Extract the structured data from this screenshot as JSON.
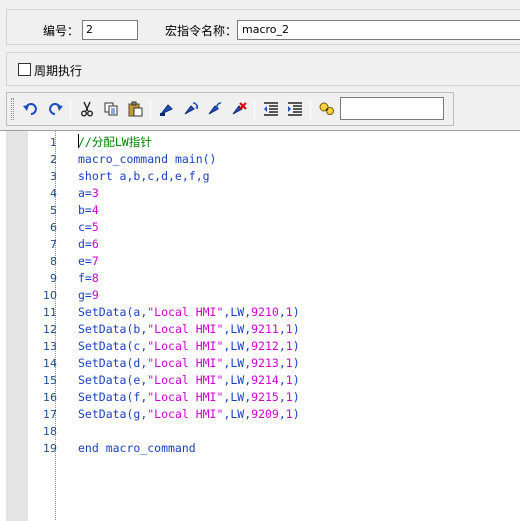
{
  "header": {
    "id_label": "编号：",
    "id_value": "2",
    "name_label": "宏指令名称：",
    "name_value": "macro_2"
  },
  "options": {
    "periodic_label": "周期执行",
    "periodic_checked": false
  },
  "toolbar": {
    "buttons": [
      "undo-icon",
      "redo-icon",
      "cut-icon",
      "copy-icon",
      "paste-icon",
      "bookmark-toggle-icon",
      "bookmark-next-icon",
      "bookmark-prev-icon",
      "bookmark-clear-icon",
      "outdent-icon",
      "indent-icon",
      "find-icon"
    ],
    "search_value": ""
  },
  "editor": {
    "line_numbers": [
      "1",
      "2",
      "3",
      "4",
      "5",
      "6",
      "7",
      "8",
      "9",
      "10",
      "11",
      "12",
      "13",
      "14",
      "15",
      "16",
      "17",
      "18",
      "19"
    ],
    "lines": [
      [
        {
          "t": "//分配LW指针",
          "c": "cmt"
        }
      ],
      [
        {
          "t": "macro_command",
          "c": "kw"
        },
        {
          "t": " main()",
          "c": "plain"
        }
      ],
      [
        {
          "t": "short",
          "c": "kw"
        },
        {
          "t": " a,b,c,d,e,f,g",
          "c": "plain"
        }
      ],
      [
        {
          "t": "a=",
          "c": "plain"
        },
        {
          "t": "3",
          "c": "num"
        }
      ],
      [
        {
          "t": "b=",
          "c": "plain"
        },
        {
          "t": "4",
          "c": "num"
        }
      ],
      [
        {
          "t": "c=",
          "c": "plain"
        },
        {
          "t": "5",
          "c": "num"
        }
      ],
      [
        {
          "t": "d=",
          "c": "plain"
        },
        {
          "t": "6",
          "c": "num"
        }
      ],
      [
        {
          "t": "e=",
          "c": "plain"
        },
        {
          "t": "7",
          "c": "num"
        }
      ],
      [
        {
          "t": "f=",
          "c": "plain"
        },
        {
          "t": "8",
          "c": "num"
        }
      ],
      [
        {
          "t": "g=",
          "c": "plain"
        },
        {
          "t": "9",
          "c": "num"
        }
      ],
      [
        {
          "t": "SetData",
          "c": "fn"
        },
        {
          "t": "(a,",
          "c": "plain"
        },
        {
          "t": "\"Local HMI\"",
          "c": "str"
        },
        {
          "t": ",LW,",
          "c": "plain"
        },
        {
          "t": "9210",
          "c": "num"
        },
        {
          "t": ",",
          "c": "plain"
        },
        {
          "t": "1",
          "c": "num"
        },
        {
          "t": ")",
          "c": "plain"
        }
      ],
      [
        {
          "t": "SetData",
          "c": "fn"
        },
        {
          "t": "(b,",
          "c": "plain"
        },
        {
          "t": "\"Local HMI\"",
          "c": "str"
        },
        {
          "t": ",LW,",
          "c": "plain"
        },
        {
          "t": "9211",
          "c": "num"
        },
        {
          "t": ",",
          "c": "plain"
        },
        {
          "t": "1",
          "c": "num"
        },
        {
          "t": ")",
          "c": "plain"
        }
      ],
      [
        {
          "t": "SetData",
          "c": "fn"
        },
        {
          "t": "(c,",
          "c": "plain"
        },
        {
          "t": "\"Local HMI\"",
          "c": "str"
        },
        {
          "t": ",LW,",
          "c": "plain"
        },
        {
          "t": "9212",
          "c": "num"
        },
        {
          "t": ",",
          "c": "plain"
        },
        {
          "t": "1",
          "c": "num"
        },
        {
          "t": ")",
          "c": "plain"
        }
      ],
      [
        {
          "t": "SetData",
          "c": "fn"
        },
        {
          "t": "(d,",
          "c": "plain"
        },
        {
          "t": "\"Local HMI\"",
          "c": "str"
        },
        {
          "t": ",LW,",
          "c": "plain"
        },
        {
          "t": "9213",
          "c": "num"
        },
        {
          "t": ",",
          "c": "plain"
        },
        {
          "t": "1",
          "c": "num"
        },
        {
          "t": ")",
          "c": "plain"
        }
      ],
      [
        {
          "t": "SetData",
          "c": "fn"
        },
        {
          "t": "(e,",
          "c": "plain"
        },
        {
          "t": "\"Local HMI\"",
          "c": "str"
        },
        {
          "t": ",LW,",
          "c": "plain"
        },
        {
          "t": "9214",
          "c": "num"
        },
        {
          "t": ",",
          "c": "plain"
        },
        {
          "t": "1",
          "c": "num"
        },
        {
          "t": ")",
          "c": "plain"
        }
      ],
      [
        {
          "t": "SetData",
          "c": "fn"
        },
        {
          "t": "(f,",
          "c": "plain"
        },
        {
          "t": "\"Local HMI\"",
          "c": "str"
        },
        {
          "t": ",LW,",
          "c": "plain"
        },
        {
          "t": "9215",
          "c": "num"
        },
        {
          "t": ",",
          "c": "plain"
        },
        {
          "t": "1",
          "c": "num"
        },
        {
          "t": ")",
          "c": "plain"
        }
      ],
      [
        {
          "t": "SetData",
          "c": "fn"
        },
        {
          "t": "(g,",
          "c": "plain"
        },
        {
          "t": "\"Local HMI\"",
          "c": "str"
        },
        {
          "t": ",LW,",
          "c": "plain"
        },
        {
          "t": "9209",
          "c": "num"
        },
        {
          "t": ",",
          "c": "plain"
        },
        {
          "t": "1",
          "c": "num"
        },
        {
          "t": ")",
          "c": "plain"
        }
      ],
      [],
      [
        {
          "t": "end macro_command",
          "c": "kw"
        }
      ]
    ]
  },
  "colors": {
    "keyword": "#1a3fc4",
    "number": "#d000d0",
    "string": "#d000d0",
    "comment": "#008000",
    "line_number": "#1a4b8a"
  }
}
